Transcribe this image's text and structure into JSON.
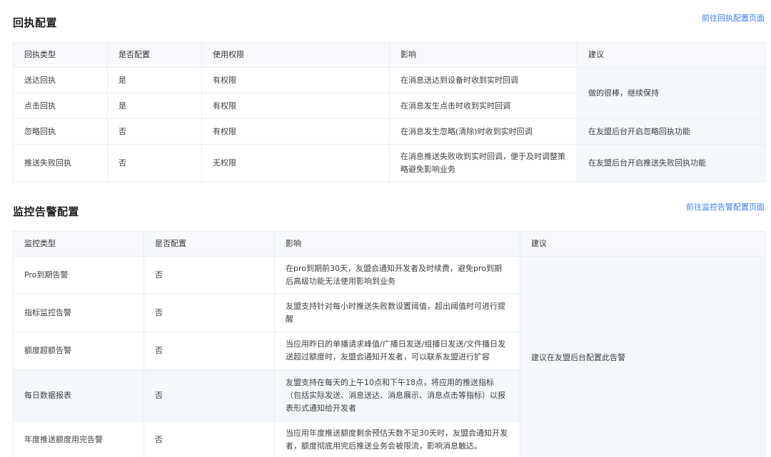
{
  "receipt": {
    "title": "回执配置",
    "link": "前往回执配置页面",
    "headers": [
      "回执类型",
      "是否配置",
      "使用权限",
      "影响",
      "建议"
    ],
    "rows": [
      {
        "type": "送达回执",
        "configured": "是",
        "permission": "有权限",
        "impact": "在消息送达到设备时收到实时回调"
      },
      {
        "type": "点击回执",
        "configured": "是",
        "permission": "有权限",
        "impact": "在消息发生点击时收到实时回调"
      },
      {
        "type": "忽略回执",
        "configured": "否",
        "permission": "有权限",
        "impact": "在消息发生忽略(清除)时收到实时回调",
        "suggestion": "在友盟后台开启忽略回执功能"
      },
      {
        "type": "推送失败回执",
        "configured": "否",
        "permission": "无权限",
        "impact": "在消息推送失败收到实时回调，便于及时调整策略避免影响业务",
        "suggestion": "在友盟后台开启推送失败回执功能"
      }
    ],
    "merged_suggestion": "做的很棒，继续保持"
  },
  "monitor": {
    "title": "监控告警配置",
    "link": "前往监控告警配置页面",
    "headers": [
      "监控类型",
      "是否配置",
      "影响",
      "建议"
    ],
    "rows": [
      {
        "type": "Pro到期告警",
        "configured": "否",
        "impact": "在pro到期前30天，友盟会通知开发者及时续费，避免pro到期后高级功能无法使用影响到业务"
      },
      {
        "type": "指标监控告警",
        "configured": "否",
        "impact": "友盟支持针对每小时推送失败数设置阈值，超出阈值时可进行提醒"
      },
      {
        "type": "额度超额告警",
        "configured": "否",
        "impact": "当应用昨日的单播请求峰值/广播日发送/组播日发送/文件播日发送超过额度时，友盟会通知开发者，可以联系友盟进行扩容"
      },
      {
        "type": "每日数据报表",
        "configured": "否",
        "impact": "友盟支持在每天的上午10点和下午18点，将应用的推送指标（包括实际发送、消息送达、消息展示、消息点击等指标）以报表形式通知给开发者"
      },
      {
        "type": "年度推送额度用完告警",
        "configured": "否",
        "impact": "当应用年度推送额度剩余预估天数不足30天时，友盟会通知开发者，额度彻底用完后推送业务会被限流，影响消息触达。"
      }
    ],
    "merged_suggestion": "建议在友盟后台配置此告警"
  }
}
